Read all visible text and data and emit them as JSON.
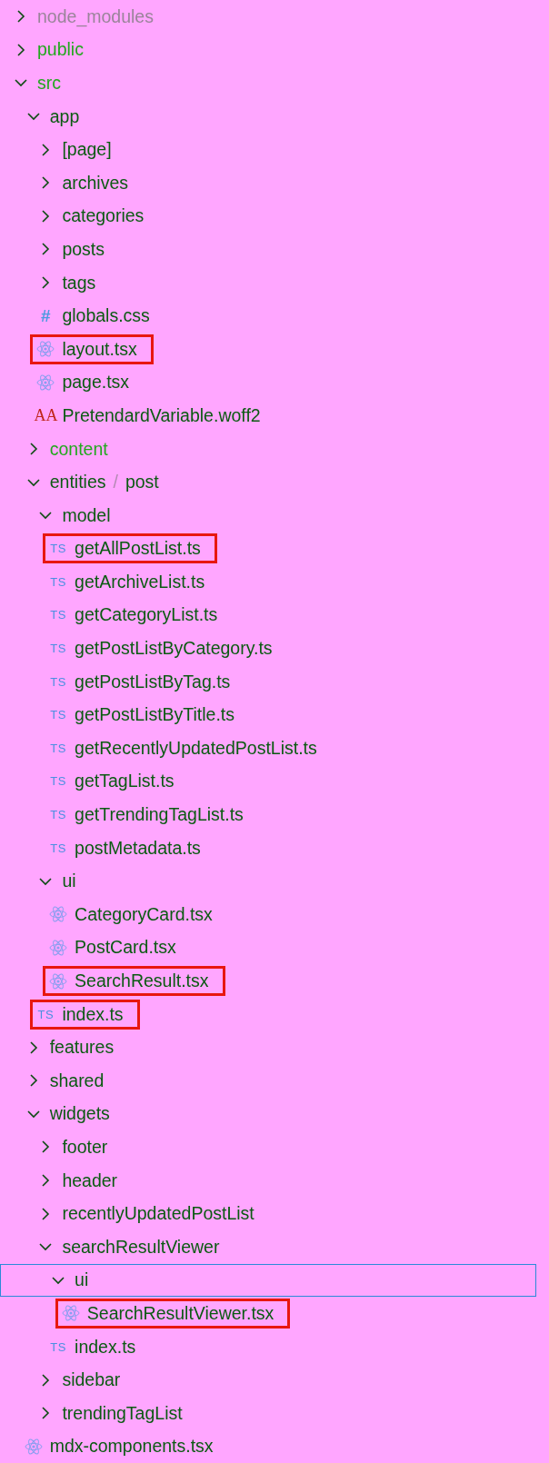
{
  "explorer": {
    "tree": [
      {
        "kind": "folder",
        "name": "node_modules",
        "color": "#9a849a",
        "expanded": false
      },
      {
        "kind": "folder",
        "name": "public",
        "color": "#22a81e",
        "expanded": false
      },
      {
        "kind": "folder",
        "name": "src",
        "color": "#22a81e",
        "expanded": true,
        "children": [
          {
            "kind": "folder",
            "name": "app",
            "color": "#0b5a12",
            "expanded": true,
            "children": [
              {
                "kind": "folder",
                "name": "[page]",
                "color": "#0b5a12",
                "expanded": false
              },
              {
                "kind": "folder",
                "name": "archives",
                "color": "#0b5a12",
                "expanded": false
              },
              {
                "kind": "folder",
                "name": "categories",
                "color": "#0b5a12",
                "expanded": false
              },
              {
                "kind": "folder",
                "name": "posts",
                "color": "#0b5a12",
                "expanded": false
              },
              {
                "kind": "folder",
                "name": "tags",
                "color": "#0b5a12",
                "expanded": false
              },
              {
                "kind": "css",
                "icon": "#",
                "name": "globals.css",
                "color": "#0b5a12"
              },
              {
                "kind": "react",
                "name": "layout.tsx",
                "color": "#0b5a12",
                "boxed": true
              },
              {
                "kind": "react",
                "name": "page.tsx",
                "color": "#0b5a12"
              },
              {
                "kind": "font",
                "icon": "AA",
                "name": "PretendardVariable.woff2",
                "color": "#0b5a12"
              }
            ]
          },
          {
            "kind": "folder",
            "name": "content",
            "color": "#22a81e",
            "expanded": false
          },
          {
            "kind": "folder",
            "segments": [
              "entities",
              "/",
              "post"
            ],
            "color": "#0b5a12",
            "expanded": true,
            "children": [
              {
                "kind": "folder",
                "name": "model",
                "color": "#0b5a12",
                "expanded": true,
                "children": [
                  {
                    "kind": "ts",
                    "icon": "TS",
                    "name": "getAllPostList.ts",
                    "color": "#0b5a12",
                    "boxed": true
                  },
                  {
                    "kind": "ts",
                    "icon": "TS",
                    "name": "getArchiveList.ts",
                    "color": "#0b5a12"
                  },
                  {
                    "kind": "ts",
                    "icon": "TS",
                    "name": "getCategoryList.ts",
                    "color": "#0b5a12"
                  },
                  {
                    "kind": "ts",
                    "icon": "TS",
                    "name": "getPostListByCategory.ts",
                    "color": "#0b5a12"
                  },
                  {
                    "kind": "ts",
                    "icon": "TS",
                    "name": "getPostListByTag.ts",
                    "color": "#0b5a12"
                  },
                  {
                    "kind": "ts",
                    "icon": "TS",
                    "name": "getPostListByTitle.ts",
                    "color": "#0b5a12"
                  },
                  {
                    "kind": "ts",
                    "icon": "TS",
                    "name": "getRecentlyUpdatedPostList.ts",
                    "color": "#0b5a12"
                  },
                  {
                    "kind": "ts",
                    "icon": "TS",
                    "name": "getTagList.ts",
                    "color": "#0b5a12"
                  },
                  {
                    "kind": "ts",
                    "icon": "TS",
                    "name": "getTrendingTagList.ts",
                    "color": "#0b5a12"
                  },
                  {
                    "kind": "ts",
                    "icon": "TS",
                    "name": "postMetadata.ts",
                    "color": "#0b5a12"
                  }
                ]
              },
              {
                "kind": "folder",
                "name": "ui",
                "color": "#0b5a12",
                "expanded": true,
                "children": [
                  {
                    "kind": "react",
                    "name": "CategoryCard.tsx",
                    "color": "#0b5a12"
                  },
                  {
                    "kind": "react",
                    "name": "PostCard.tsx",
                    "color": "#0b5a12"
                  },
                  {
                    "kind": "react",
                    "name": "SearchResult.tsx",
                    "color": "#0b5a12",
                    "boxed": true
                  }
                ]
              },
              {
                "kind": "ts",
                "icon": "TS",
                "name": "index.ts",
                "color": "#0b5a12",
                "boxed": true
              }
            ]
          },
          {
            "kind": "folder",
            "name": "features",
            "color": "#0b5a12",
            "expanded": false
          },
          {
            "kind": "folder",
            "name": "shared",
            "color": "#0b5a12",
            "expanded": false
          },
          {
            "kind": "folder",
            "name": "widgets",
            "color": "#0b5a12",
            "expanded": true,
            "children": [
              {
                "kind": "folder",
                "name": "footer",
                "color": "#0b5a12",
                "expanded": false
              },
              {
                "kind": "folder",
                "name": "header",
                "color": "#0b5a12",
                "expanded": false
              },
              {
                "kind": "folder",
                "name": "recentlyUpdatedPostList",
                "color": "#0b5a12",
                "expanded": false
              },
              {
                "kind": "folder",
                "name": "searchResultViewer",
                "color": "#0b5a12",
                "expanded": true,
                "children": [
                  {
                    "kind": "folder",
                    "name": "ui",
                    "color": "#0b5a12",
                    "expanded": true,
                    "focused": true,
                    "children": [
                      {
                        "kind": "react",
                        "name": "SearchResultViewer.tsx",
                        "color": "#0b5a12",
                        "boxed": true
                      }
                    ]
                  },
                  {
                    "kind": "ts",
                    "icon": "TS",
                    "name": "index.ts",
                    "color": "#0b5a12"
                  }
                ]
              },
              {
                "kind": "folder",
                "name": "sidebar",
                "color": "#0b5a12",
                "expanded": false
              },
              {
                "kind": "folder",
                "name": "trendingTagList",
                "color": "#0b5a12",
                "expanded": false
              }
            ]
          },
          {
            "kind": "react",
            "name": "mdx-components.tsx",
            "color": "#0b5a12"
          }
        ]
      }
    ]
  }
}
